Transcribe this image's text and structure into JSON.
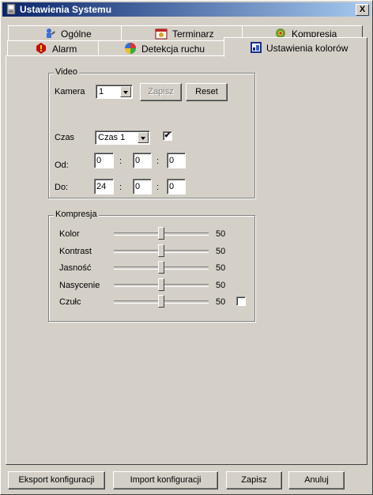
{
  "window": {
    "title": "Ustawienia Systemu",
    "close_label": "X"
  },
  "tabs_back": [
    {
      "label": "Ogólne",
      "icon": "user-wrench-icon"
    },
    {
      "label": "Terminarz",
      "icon": "scheduler-icon"
    },
    {
      "label": "Kompresja",
      "icon": "camera-compression-icon"
    }
  ],
  "tabs_front": [
    {
      "label": "Alarm",
      "icon": "alarm-icon"
    },
    {
      "label": "Detekcja ruchu",
      "icon": "motion-detection-icon"
    },
    {
      "label": "Ustawienia kolorów",
      "icon": "color-settings-icon",
      "active": true
    }
  ],
  "video": {
    "legend": "Video",
    "camera_label": "Kamera",
    "camera_value": "1",
    "save_label": "Zapisz",
    "reset_label": "Reset",
    "time_label": "Czas",
    "time_value": "Czas 1",
    "time_checked": true,
    "from_label": "Od:",
    "from": [
      "0",
      "0",
      "0"
    ],
    "to_label": "Do:",
    "to": [
      "24",
      "0",
      "0"
    ],
    "separator": ":"
  },
  "compression": {
    "legend": "Kompresja",
    "sliders": [
      {
        "label": "Kolor",
        "value": 50,
        "value_text": "50"
      },
      {
        "label": "Kontrast",
        "value": 50,
        "value_text": "50"
      },
      {
        "label": "Jasność",
        "value": 50,
        "value_text": "50"
      },
      {
        "label": "Nasycenie",
        "value": 50,
        "value_text": "50"
      },
      {
        "label": "Czułc",
        "value": 50,
        "value_text": "50"
      }
    ],
    "sensitivity_checked": false
  },
  "footer": {
    "export_label": "Eksport konfiguracji",
    "import_label": "Import konfiguracji",
    "save_label": "Zapisz",
    "cancel_label": "Anuluj"
  }
}
